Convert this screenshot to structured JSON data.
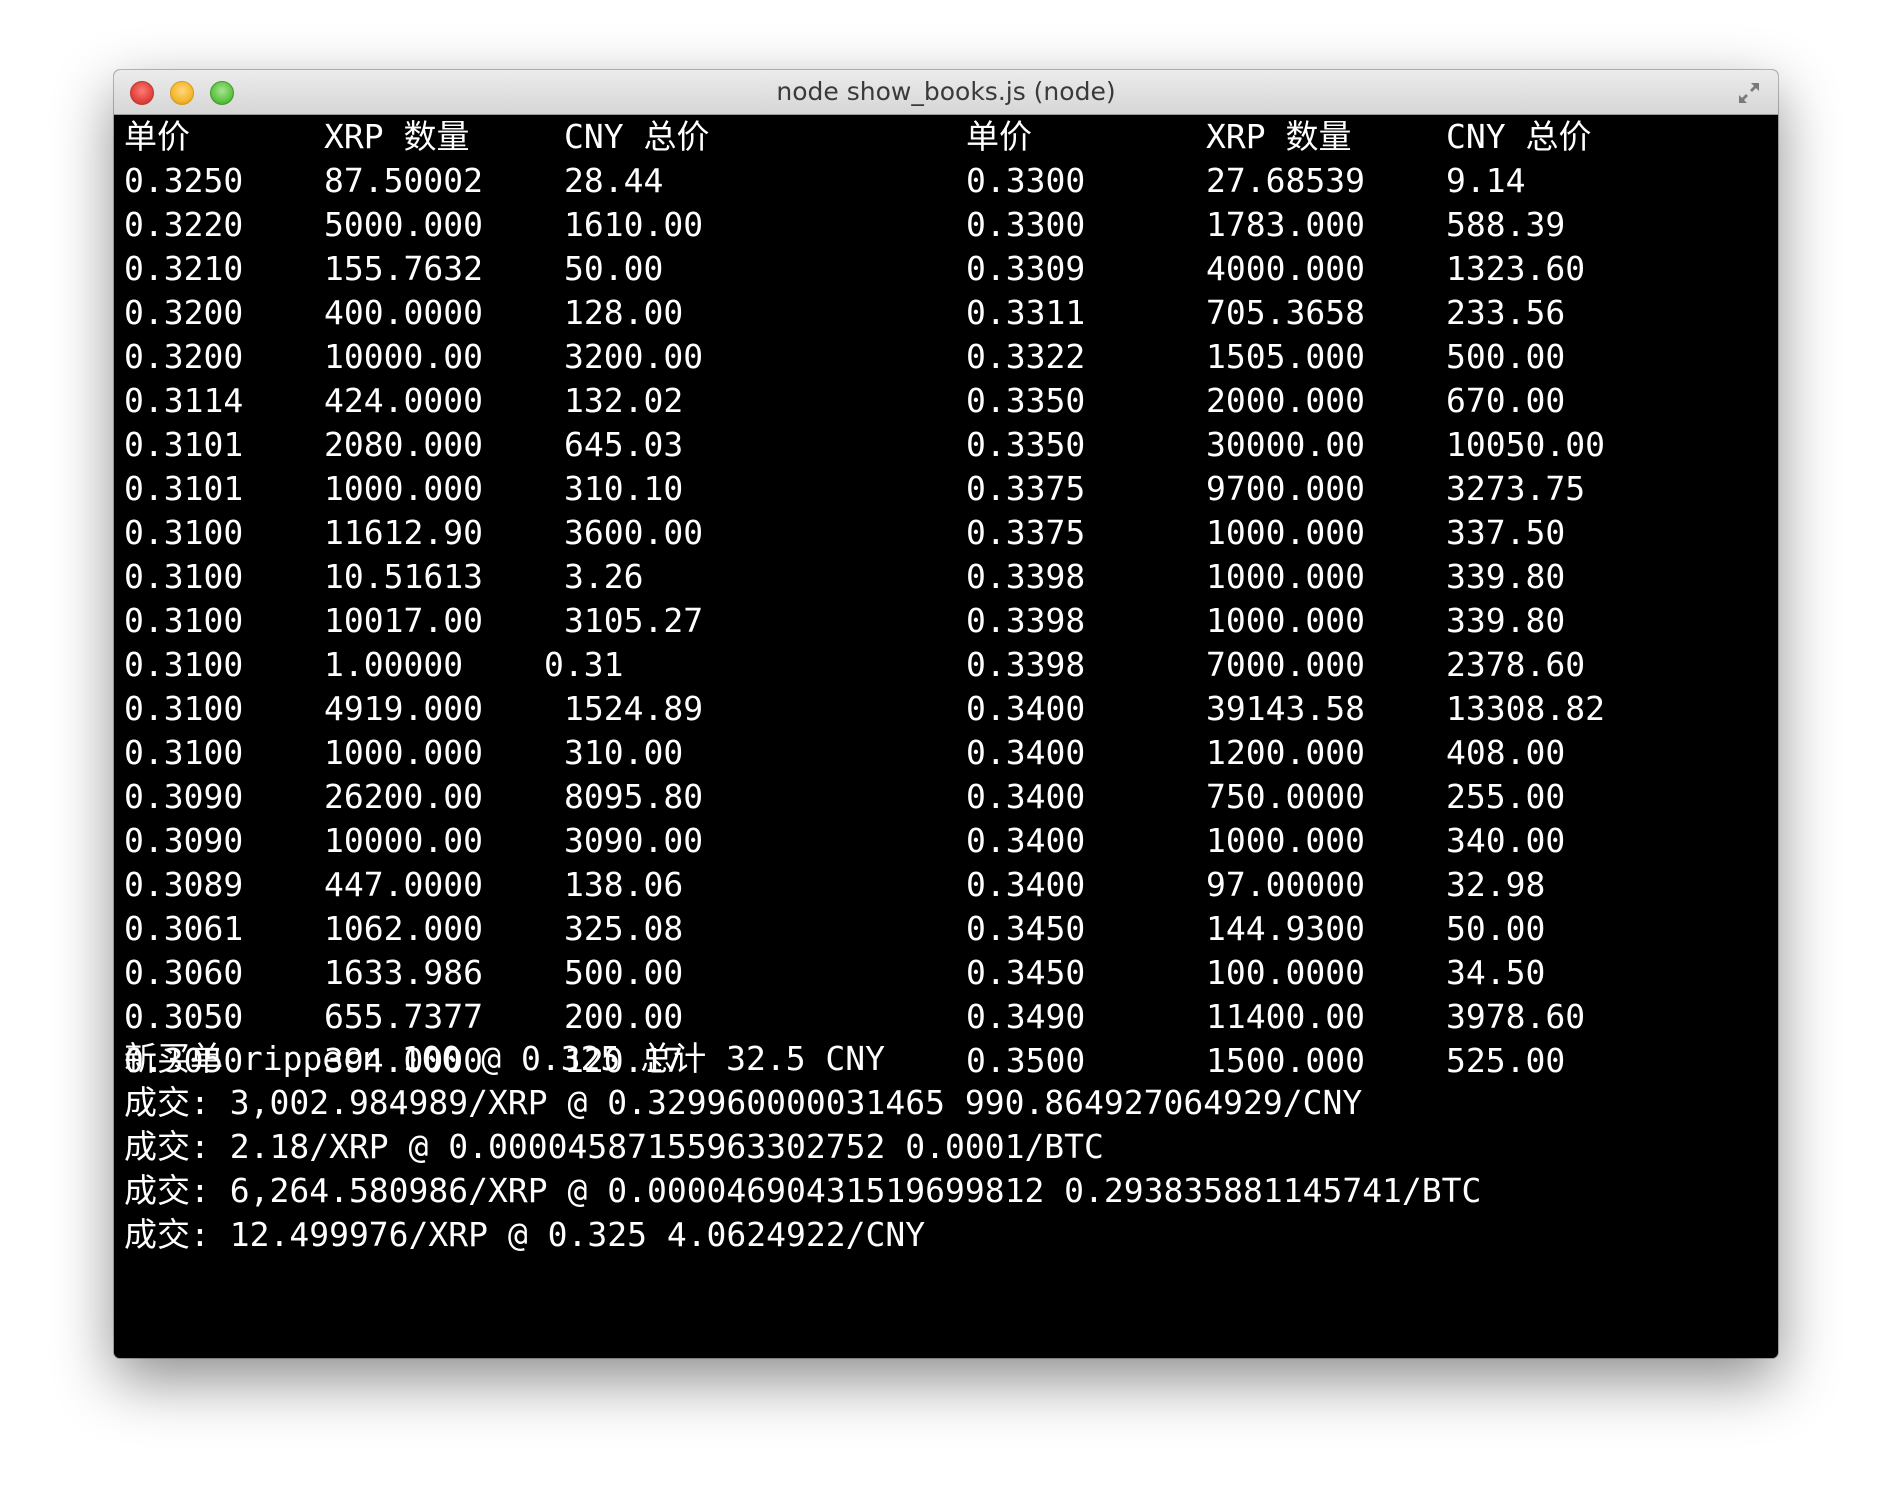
{
  "window": {
    "title": "node show_books.js (node)",
    "buttons": [
      "close-button",
      "minimize-button",
      "zoom-button"
    ]
  },
  "orderbook": {
    "headers": [
      "单价",
      "XRP 数量",
      "CNY 总价",
      "单价",
      "XRP 数量",
      "CNY 总价"
    ],
    "bids": [
      [
        "0.3250",
        "87.50002",
        "28.44"
      ],
      [
        "0.3220",
        "5000.000",
        "1610.00"
      ],
      [
        "0.3210",
        "155.7632",
        "50.00"
      ],
      [
        "0.3200",
        "400.0000",
        "128.00"
      ],
      [
        "0.3200",
        "10000.00",
        "3200.00"
      ],
      [
        "0.3114",
        "424.0000",
        "132.02"
      ],
      [
        "0.3101",
        "2080.000",
        "645.03"
      ],
      [
        "0.3101",
        "1000.000",
        "310.10"
      ],
      [
        "0.3100",
        "11612.90",
        "3600.00"
      ],
      [
        "0.3100",
        "10.51613",
        "3.26"
      ],
      [
        "0.3100",
        "10017.00",
        "3105.27"
      ],
      [
        "0.3100",
        "1.00000",
        "0.31"
      ],
      [
        "0.3100",
        "4919.000",
        "1524.89"
      ],
      [
        "0.3100",
        "1000.000",
        "310.00"
      ],
      [
        "0.3090",
        "26200.00",
        "8095.80"
      ],
      [
        "0.3090",
        "10000.00",
        "3090.00"
      ],
      [
        "0.3089",
        "447.0000",
        "138.06"
      ],
      [
        "0.3061",
        "1062.000",
        "325.08"
      ],
      [
        "0.3060",
        "1633.986",
        "500.00"
      ],
      [
        "0.3050",
        "655.7377",
        "200.00"
      ],
      [
        "0.3050",
        "394.0000",
        "120.17"
      ]
    ],
    "asks": [
      [
        "0.3300",
        "27.68539",
        "9.14"
      ],
      [
        "0.3300",
        "1783.000",
        "588.39"
      ],
      [
        "0.3309",
        "4000.000",
        "1323.60"
      ],
      [
        "0.3311",
        "705.3658",
        "233.56"
      ],
      [
        "0.3322",
        "1505.000",
        "500.00"
      ],
      [
        "0.3350",
        "2000.000",
        "670.00"
      ],
      [
        "0.3350",
        "30000.00",
        "10050.00"
      ],
      [
        "0.3375",
        "9700.000",
        "3273.75"
      ],
      [
        "0.3375",
        "1000.000",
        "337.50"
      ],
      [
        "0.3398",
        "1000.000",
        "339.80"
      ],
      [
        "0.3398",
        "1000.000",
        "339.80"
      ],
      [
        "0.3398",
        "7000.000",
        "2378.60"
      ],
      [
        "0.3400",
        "39143.58",
        "13308.82"
      ],
      [
        "0.3400",
        "1200.000",
        "408.00"
      ],
      [
        "0.3400",
        "750.0000",
        "255.00"
      ],
      [
        "0.3400",
        "1000.000",
        "340.00"
      ],
      [
        "0.3400",
        "97.00000",
        "32.98"
      ],
      [
        "0.3450",
        "144.9300",
        "50.00"
      ],
      [
        "0.3450",
        "100.0000",
        "34.50"
      ],
      [
        "0.3490",
        "11400.00",
        "3978.60"
      ],
      [
        "0.3500",
        "1500.000",
        "525.00"
      ]
    ]
  },
  "messages": [
    "新买单 rippecn 100 @ 0.325 总计 32.5 CNY",
    "成交: 3,002.984989/XRP @ 0.329960000031465 990.864927064929/CNY",
    "成交: 2.18/XRP @ 0.00004587155963302752 0.0001/BTC",
    "成交: 6,264.580986/XRP @ 0.00004690431519699812 0.293835881145741/BTC",
    "成交: 12.499976/XRP @ 0.325 4.0624922/CNY"
  ]
}
